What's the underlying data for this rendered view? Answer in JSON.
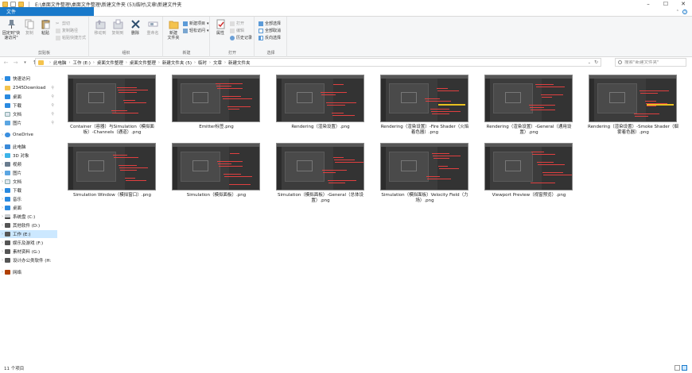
{
  "title_path": "E:\\桌面文件整理\\桌面文件整理\\新建文件夹 (5)\\临时\\文章\\新建文件夹",
  "window_controls": [
    "–",
    "☐",
    "✕"
  ],
  "tabs": [
    "文件",
    "主页",
    "共享",
    "查看"
  ],
  "ribbon": {
    "clipboard": {
      "label": "剪贴板",
      "pin": "固定到\"快\n速访问\"",
      "copy": "复制",
      "paste": "粘贴",
      "copy_path": "复制路径",
      "paste_shortcut": "粘贴快捷方式",
      "cut": "剪切"
    },
    "organize": {
      "label": "组织",
      "move_to": "移动到",
      "copy_to": "复制到",
      "delete": "删除",
      "rename": "重命名"
    },
    "new": {
      "label": "新建",
      "new_folder": "新建\n文件夹",
      "new_item": "新建项目",
      "easy_access": "轻松访问"
    },
    "open": {
      "label": "打开",
      "properties": "属性",
      "open": "打开",
      "edit": "编辑",
      "history": "历史记录"
    },
    "select": {
      "label": "选择",
      "select_all": "全部选择",
      "select_none": "全部取消",
      "invert": "反向选择"
    }
  },
  "breadcrumb": [
    "此电脑",
    "工作 (E:)",
    "桌面文件整理",
    "桌面文件整理",
    "新建文件夹 (5)",
    "临时",
    "文章",
    "新建文件夹"
  ],
  "search": {
    "placeholder": "搜索\"新建文件夹\""
  },
  "nav": {
    "quick_access": "快速访问",
    "items": [
      {
        "label": "2345Download",
        "icon": "folder-icon",
        "pinned": true
      },
      {
        "label": "桌面",
        "icon": "desktop-icon",
        "pinned": true
      },
      {
        "label": "下载",
        "icon": "download-icon",
        "pinned": true
      },
      {
        "label": "文档",
        "icon": "document-icon",
        "pinned": true
      },
      {
        "label": "图片",
        "icon": "picture-icon",
        "pinned": true
      }
    ],
    "onedrive": "OneDrive",
    "this_pc": "此电脑",
    "pc_items": [
      {
        "label": "3D 对象",
        "icon": "3d-objects-icon"
      },
      {
        "label": "视频",
        "icon": "video-icon"
      },
      {
        "label": "图片",
        "icon": "picture-icon"
      },
      {
        "label": "文档",
        "icon": "document-icon"
      },
      {
        "label": "下载",
        "icon": "download-icon"
      },
      {
        "label": "音乐",
        "icon": "music-icon"
      },
      {
        "label": "桌面",
        "icon": "desktop-icon"
      },
      {
        "label": "系统盘 (C:)",
        "icon": "drive-icon"
      },
      {
        "label": "其他软件 (D:)",
        "icon": "drive-icon"
      },
      {
        "label": "工作 (E:)",
        "icon": "drive-icon",
        "selected": true
      },
      {
        "label": "娱乐及游戏 (F:)",
        "icon": "drive-icon"
      },
      {
        "label": "素材资料 (G:)",
        "icon": "drive-icon"
      },
      {
        "label": "设计办公类软件 (H:",
        "icon": "drive-icon"
      }
    ],
    "network": "网络"
  },
  "files": [
    {
      "name": "Container（容器）与Simulation（模拟面板）-Channels（通道）.png"
    },
    {
      "name": "Emitter标签.png"
    },
    {
      "name": "Rendering（渲染设置）.png"
    },
    {
      "name": "Rendering（渲染设置）-Fire Shader（火焰着色器）.png"
    },
    {
      "name": "Rendering（渲染设置）-General（通用设置）.png"
    },
    {
      "name": "Rendering（渲染设置）-Smoke Shader（烟雾着色器）.png"
    },
    {
      "name": "Simulation Window（模拟窗口）.png"
    },
    {
      "name": "Simulation（模拟面板）.png"
    },
    {
      "name": "Simulation（模拟面板）-General（总体设置）.png"
    },
    {
      "name": "Simulation（模拟面板）Velocity Field（力场）.png"
    },
    {
      "name": "Viewport Preview（视窗预览）.png"
    }
  ],
  "status": "11 个项目"
}
